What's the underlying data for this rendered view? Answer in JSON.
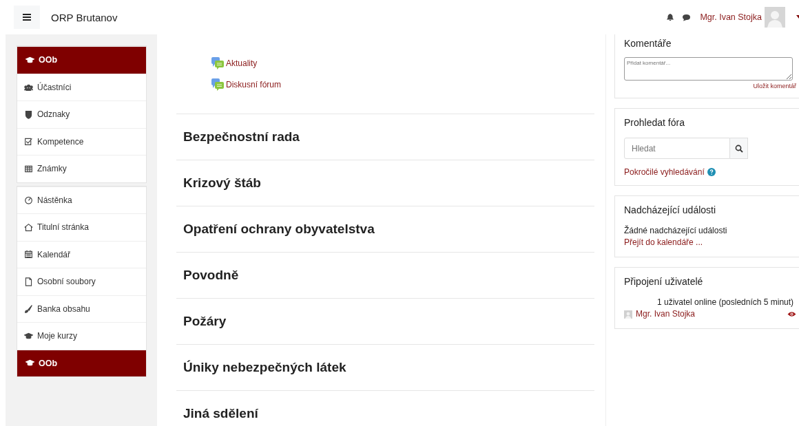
{
  "navbar": {
    "site_name": "ORP Brutanov",
    "user_name": "Mgr. Ivan Stojka"
  },
  "sidebar": {
    "groups": [
      {
        "items": [
          {
            "label": "OOb",
            "selected": true
          },
          {
            "label": "Účastníci",
            "selected": false
          },
          {
            "label": "Odznaky",
            "selected": false
          },
          {
            "label": "Kompetence",
            "selected": false
          },
          {
            "label": "Známky",
            "selected": false
          }
        ]
      },
      {
        "items": [
          {
            "label": "Nástěnka",
            "selected": false
          },
          {
            "label": "Titulní stránka",
            "selected": false
          },
          {
            "label": "Kalendář",
            "selected": false
          },
          {
            "label": "Osobní soubory",
            "selected": false
          },
          {
            "label": "Banka obsahu",
            "selected": false
          },
          {
            "label": "Moje kurzy",
            "selected": false
          },
          {
            "label": "OOb",
            "selected": true
          }
        ]
      }
    ]
  },
  "activities": [
    "Aktuality",
    "Diskusní fórum"
  ],
  "sections": [
    "Bezpečnostní rada",
    "Krizový štáb",
    "Opatření ochrany obyvatelstva",
    "Povodně",
    "Požáry",
    "Úniky nebezpečných látek",
    "Jiná sdělení"
  ],
  "comments": {
    "title": "Komentáře",
    "placeholder": "Přidat komentář...",
    "save": "Uložit komentář"
  },
  "forum_search": {
    "title": "Prohledat fóra",
    "placeholder": "Hledat",
    "advanced": "Pokročilé vyhledávání"
  },
  "upcoming": {
    "title": "Nadcházející události",
    "empty": "Žádné nadcházející události",
    "link": "Přejít do kalendáře ..."
  },
  "online_users": {
    "title": "Připojení uživatelé",
    "summary": "1 uživatel online (posledních 5 minut)",
    "users": [
      "Mgr. Ivan Stojka"
    ]
  }
}
